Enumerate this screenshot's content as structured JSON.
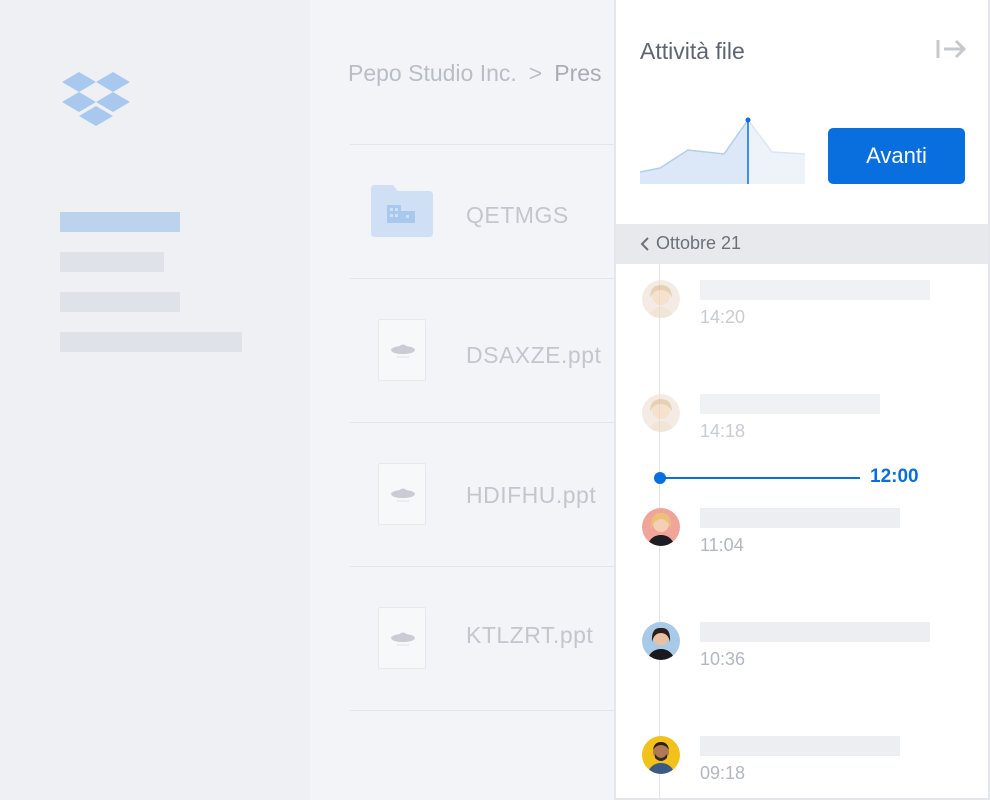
{
  "colors": {
    "accent": "#0a6fde",
    "sidebar_bg": "#eef0f4",
    "panel_bg": "#ffffff"
  },
  "breadcrumb": {
    "root": "Pepo Studio Inc.",
    "separator": ">",
    "current": "Pres"
  },
  "files": [
    {
      "name": "QETMGS",
      "type": "folder",
      "icon": "shared-folder-icon"
    },
    {
      "name": "DSAXZE.ppt",
      "type": "file",
      "icon": "ppt-file-icon"
    },
    {
      "name": "HDIFHU.ppt",
      "type": "file",
      "icon": "ppt-file-icon"
    },
    {
      "name": "KTLZRT.ppt",
      "type": "file",
      "icon": "ppt-file-icon"
    }
  ],
  "panel": {
    "title": "Attività file",
    "next_label": "Avanti",
    "date_label": "Ottobre 21",
    "now_label": "12:00",
    "events": [
      {
        "time": "14:20",
        "avatar": "avatar-blonde-woman",
        "dim": true
      },
      {
        "time": "14:18",
        "avatar": "avatar-blonde-woman",
        "dim": true
      },
      {
        "time": "11:04",
        "avatar": "avatar-woman-red-bg",
        "dim": false
      },
      {
        "time": "10:36",
        "avatar": "avatar-woman-blue-bg",
        "dim": false
      },
      {
        "time": "09:18",
        "avatar": "avatar-man-yellow-bg",
        "dim": false
      }
    ]
  }
}
